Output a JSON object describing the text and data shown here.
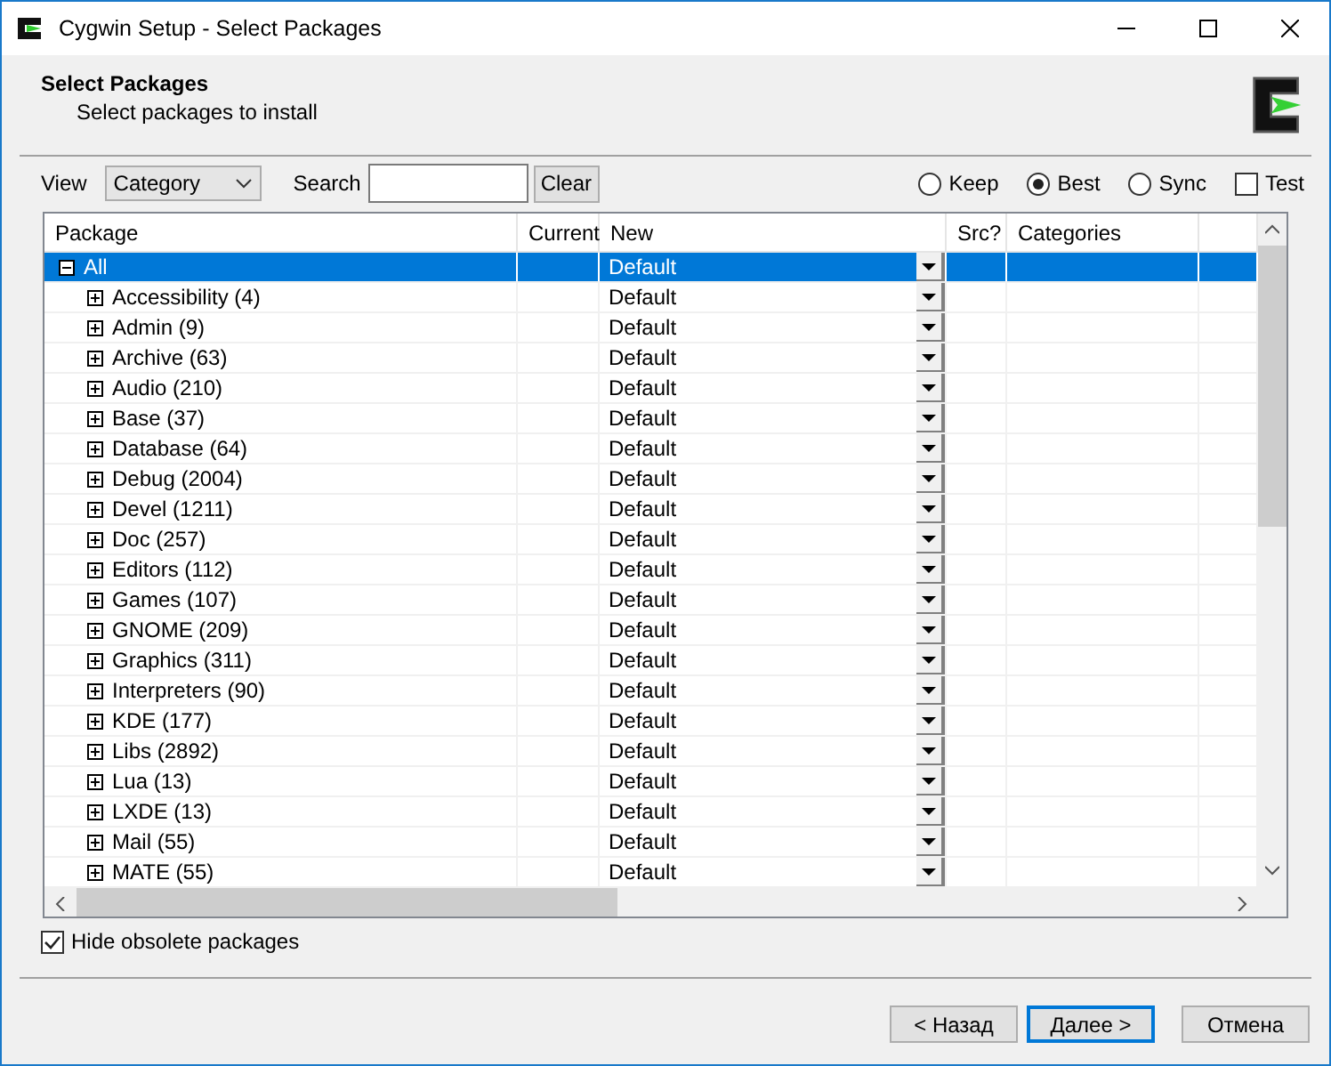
{
  "window": {
    "title": "Cygwin Setup - Select Packages"
  },
  "header": {
    "title": "Select Packages",
    "subtitle": "Select packages to install"
  },
  "toolbar": {
    "view_label": "View",
    "view_value": "Category",
    "search_label": "Search",
    "clear_button": "Clear",
    "options": [
      {
        "kind": "radio",
        "label": "Keep",
        "selected": false
      },
      {
        "kind": "radio",
        "label": "Best",
        "selected": true
      },
      {
        "kind": "radio",
        "label": "Sync",
        "selected": false
      },
      {
        "kind": "checkbox",
        "label": "Test",
        "checked": false
      }
    ]
  },
  "table": {
    "columns": [
      "Package",
      "Current",
      "New",
      "Src?",
      "Categories"
    ],
    "rows": [
      {
        "package": "All",
        "new": "Default",
        "expanded": true,
        "selected": true,
        "children": [
          {
            "package": "Accessibility (4)",
            "new": "Default",
            "expanded": false,
            "selected": false
          },
          {
            "package": "Admin (9)",
            "new": "Default",
            "expanded": false,
            "selected": false
          },
          {
            "package": "Archive (63)",
            "new": "Default",
            "expanded": false,
            "selected": false
          },
          {
            "package": "Audio (210)",
            "new": "Default",
            "expanded": false,
            "selected": false
          },
          {
            "package": "Base (37)",
            "new": "Default",
            "expanded": false,
            "selected": false
          },
          {
            "package": "Database (64)",
            "new": "Default",
            "expanded": false,
            "selected": false
          },
          {
            "package": "Debug (2004)",
            "new": "Default",
            "expanded": false,
            "selected": false
          },
          {
            "package": "Devel (1211)",
            "new": "Default",
            "expanded": false,
            "selected": false
          },
          {
            "package": "Doc (257)",
            "new": "Default",
            "expanded": false,
            "selected": false
          },
          {
            "package": "Editors (112)",
            "new": "Default",
            "expanded": false,
            "selected": false
          },
          {
            "package": "Games (107)",
            "new": "Default",
            "expanded": false,
            "selected": false
          },
          {
            "package": "GNOME (209)",
            "new": "Default",
            "expanded": false,
            "selected": false
          },
          {
            "package": "Graphics (311)",
            "new": "Default",
            "expanded": false,
            "selected": false
          },
          {
            "package": "Interpreters (90)",
            "new": "Default",
            "expanded": false,
            "selected": false
          },
          {
            "package": "KDE (177)",
            "new": "Default",
            "expanded": false,
            "selected": false
          },
          {
            "package": "Libs (2892)",
            "new": "Default",
            "expanded": false,
            "selected": false
          },
          {
            "package": "Lua (13)",
            "new": "Default",
            "expanded": false,
            "selected": false
          },
          {
            "package": "LXDE (13)",
            "new": "Default",
            "expanded": false,
            "selected": false
          },
          {
            "package": "Mail (55)",
            "new": "Default",
            "expanded": false,
            "selected": false
          },
          {
            "package": "MATE (55)",
            "new": "Default",
            "expanded": false,
            "selected": false
          }
        ]
      }
    ]
  },
  "hide_obsolete": {
    "label": "Hide obsolete packages",
    "checked": true
  },
  "buttons": [
    {
      "label": "< Назад",
      "default": false
    },
    {
      "label": "Далее >",
      "default": true
    },
    {
      "label": "Отмена",
      "default": false
    }
  ]
}
